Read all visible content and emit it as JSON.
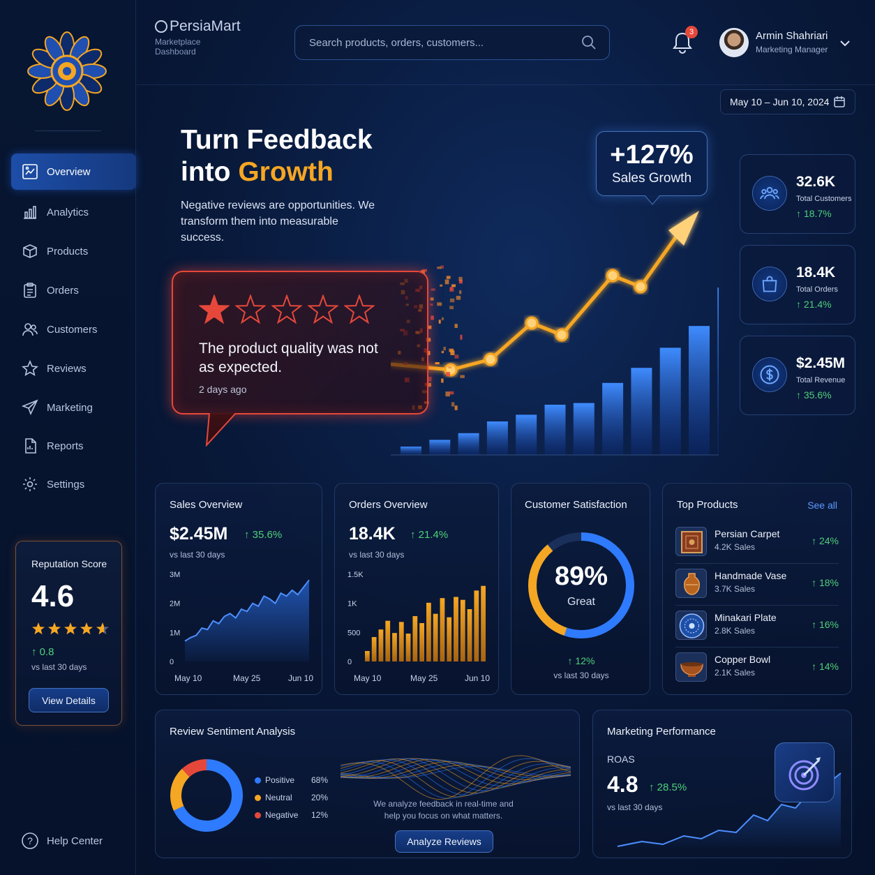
{
  "brand": {
    "name": "PersiaMart",
    "subtitle": "Marketplace Dashboard"
  },
  "search": {
    "placeholder": "Search products, orders, customers..."
  },
  "notifications": {
    "count": "3"
  },
  "user": {
    "name": "Armin Shahriari",
    "role": "Marketing Manager"
  },
  "date_range": "May 10 – Jun 10, 2024",
  "sidebar": {
    "items": [
      {
        "label": "Overview",
        "icon": "overview-icon"
      },
      {
        "label": "Analytics",
        "icon": "analytics-icon"
      },
      {
        "label": "Products",
        "icon": "box-icon"
      },
      {
        "label": "Orders",
        "icon": "clipboard-icon"
      },
      {
        "label": "Customers",
        "icon": "users-icon"
      },
      {
        "label": "Reviews",
        "icon": "star-icon"
      },
      {
        "label": "Marketing",
        "icon": "send-icon"
      },
      {
        "label": "Reports",
        "icon": "report-icon"
      },
      {
        "label": "Settings",
        "icon": "gear-icon"
      }
    ],
    "help": "Help Center"
  },
  "reputation": {
    "title": "Reputation Score",
    "score": "4.6",
    "rating": 4.6,
    "change": "0.8",
    "period": "vs last 30 days",
    "button": "View Details"
  },
  "hero": {
    "title_line1": "Turn Feedback",
    "title_line2_prefix": "into ",
    "title_line2_accent": "Growth",
    "description": "Negative reviews are opportunities. We transform them into measurable success.",
    "review": {
      "rating": 1,
      "text": "The product quality was not as expected.",
      "time": "2 days ago"
    },
    "growth_value": "+127%",
    "growth_label": "Sales Growth"
  },
  "kpis": [
    {
      "value": "32.6K",
      "label": "Total Customers",
      "change": "18.7%",
      "icon": "users-icon"
    },
    {
      "value": "18.4K",
      "label": "Total Orders",
      "change": "21.4%",
      "icon": "shopping-bag-icon"
    },
    {
      "value": "$2.45M",
      "label": "Total Revenue",
      "change": "35.6%",
      "icon": "dollar-icon"
    }
  ],
  "sales_overview": {
    "title": "Sales Overview",
    "value": "$2.45M",
    "change": "35.6%",
    "period": "vs last 30 days"
  },
  "orders_overview": {
    "title": "Orders Overview",
    "value": "18.4K",
    "change": "21.4%",
    "period": "vs last 30 days"
  },
  "satisfaction": {
    "title": "Customer Satisfaction",
    "value": "89%",
    "rating_word": "Great",
    "change": "12%",
    "period": "vs last 30 days",
    "percent": 89
  },
  "top_products": {
    "title": "Top Products",
    "see_all": "See all",
    "items": [
      {
        "name": "Persian Carpet",
        "sales": "4.2K Sales",
        "change": "24%",
        "icon": "carpet-icon"
      },
      {
        "name": "Handmade Vase",
        "sales": "3.7K Sales",
        "change": "18%",
        "icon": "vase-icon"
      },
      {
        "name": "Minakari Plate",
        "sales": "2.8K Sales",
        "change": "16%",
        "icon": "plate-icon"
      },
      {
        "name": "Copper Bowl",
        "sales": "2.1K Sales",
        "change": "14%",
        "icon": "bowl-icon"
      }
    ]
  },
  "sentiment": {
    "title": "Review Sentiment Analysis",
    "note": "We analyze feedback in real-time and help you focus on what matters.",
    "button": "Analyze Reviews"
  },
  "marketing": {
    "title": "Marketing Performance",
    "metric": "ROAS",
    "value": "4.8",
    "change": "28.5%",
    "period": "vs last 30 days"
  },
  "colors": {
    "accent_blue": "#2f7bff",
    "accent_orange": "#f5a623",
    "positive": "#4fd07a",
    "negative": "#e5483a",
    "neutral": "#f5a623"
  },
  "chart_data": [
    {
      "type": "line",
      "title": "Sales Overview",
      "x": [
        "May 10",
        "May 25",
        "Jun 10"
      ],
      "y_ticks": [
        "0",
        "1M",
        "2M",
        "3M"
      ],
      "ylim": [
        0,
        3000000
      ],
      "series": [
        {
          "values": [
            700000,
            820000,
            900000,
            1150000,
            1100000,
            1400000,
            1300000,
            1550000,
            1650000,
            1500000,
            1800000,
            1720000,
            2000000,
            1900000,
            2250000,
            2150000,
            2000000,
            2350000,
            2250000,
            2450000,
            2300000,
            2550000,
            2800000
          ]
        }
      ]
    },
    {
      "type": "bar",
      "title": "Orders Overview",
      "x": [
        "May 10",
        "May 25",
        "Jun 10"
      ],
      "y_ticks": [
        "0",
        "500",
        "1K",
        "1.5K"
      ],
      "ylim": [
        0,
        1500
      ],
      "values": [
        180,
        420,
        550,
        700,
        490,
        680,
        480,
        780,
        660,
        1010,
        820,
        1090,
        760,
        1110,
        1060,
        900,
        1220,
        1300
      ]
    },
    {
      "type": "pie",
      "title": "Review Sentiment Analysis",
      "categories": [
        "Positive",
        "Neutral",
        "Negative"
      ],
      "values": [
        68,
        20,
        12
      ],
      "labels": [
        "68%",
        "20%",
        "12%"
      ],
      "colors": [
        "#2f7bff",
        "#f5a623",
        "#e5483a"
      ]
    },
    {
      "type": "bar",
      "title": "",
      "series_bars": [
        5,
        9,
        13,
        20,
        24,
        30,
        31,
        43,
        52,
        64,
        77,
        100
      ]
    }
  ]
}
